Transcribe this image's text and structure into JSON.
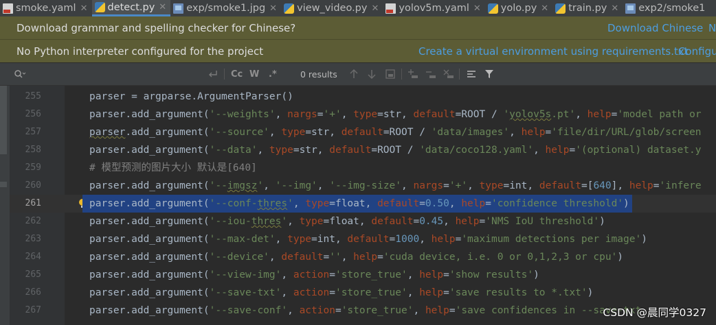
{
  "tabs": [
    {
      "label": "smoke.yaml",
      "icon": "yaml-file-icon",
      "active": false
    },
    {
      "label": "detect.py",
      "icon": "python-file-icon",
      "active": true
    },
    {
      "label": "exp/smoke1.jpg",
      "icon": "image-file-icon",
      "active": false
    },
    {
      "label": "view_video.py",
      "icon": "python-file-icon",
      "active": false
    },
    {
      "label": "yolov5m.yaml",
      "icon": "yaml-file-icon",
      "active": false
    },
    {
      "label": "yolo.py",
      "icon": "python-file-icon",
      "active": false
    },
    {
      "label": "train.py",
      "icon": "python-file-icon",
      "active": false
    },
    {
      "label": "exp2/smoke1",
      "icon": "image-file-icon",
      "active": false
    }
  ],
  "banners": {
    "grammar": {
      "message": "Download grammar and spelling checker for Chinese?",
      "link1": "Download Chinese",
      "link2": "N"
    },
    "interpreter": {
      "message": "No Python interpreter configured for the project",
      "link1": "Create a virtual environment using requirements.txt",
      "link2": "Configu"
    }
  },
  "find": {
    "results": "0 results",
    "match_case": "Cc",
    "words": "W",
    "regex": ".*"
  },
  "editor": {
    "current_line": 261,
    "lines": [
      {
        "n": "255",
        "code": "parser = argparse.ArgumentParser()"
      },
      {
        "n": "256",
        "code": "parser.add_argument('--weights', nargs='+', type=str, default=ROOT / 'yolov5s.pt', help='model path or"
      },
      {
        "n": "257",
        "code": "parser.add_argument('--source', type=str, default=ROOT / 'data/images', help='file/dir/URL/glob/screen"
      },
      {
        "n": "258",
        "code": "parser.add_argument('--data', type=str, default=ROOT / 'data/coco128.yaml', help='(optional) dataset.y"
      },
      {
        "n": "259",
        "code": "# 模型预测的图片大小 默认是[640]"
      },
      {
        "n": "260",
        "code": "parser.add_argument('--imgsz', '--img', '--img-size', nargs='+', type=int, default=[640], help='infere"
      },
      {
        "n": "261",
        "code": "parser.add_argument('--conf-thres', type=float, default=0.50, help='confidence threshold')"
      },
      {
        "n": "262",
        "code": "parser.add_argument('--iou-thres', type=float, default=0.45, help='NMS IoU threshold')"
      },
      {
        "n": "263",
        "code": "parser.add_argument('--max-det', type=int, default=1000, help='maximum detections per image')"
      },
      {
        "n": "264",
        "code": "parser.add_argument('--device', default='', help='cuda device, i.e. 0 or 0,1,2,3 or cpu')"
      },
      {
        "n": "265",
        "code": "parser.add_argument('--view-img', action='store_true', help='show results')"
      },
      {
        "n": "266",
        "code": "parser.add_argument('--save-txt', action='store_true', help='save results to *.txt')"
      },
      {
        "n": "267",
        "code": "parser.add_argument('--save-conf', action='store_true', help='save confidences in --save-txt"
      }
    ]
  },
  "watermark": "CSDN @晨同学0327",
  "colors": {
    "background": "#2b2b2b",
    "banner": "#5c5c35",
    "link": "#4d9de0",
    "selection": "#214283",
    "string": "#6a8759",
    "keyword_arg": "#aa4926",
    "number": "#6897bb"
  }
}
